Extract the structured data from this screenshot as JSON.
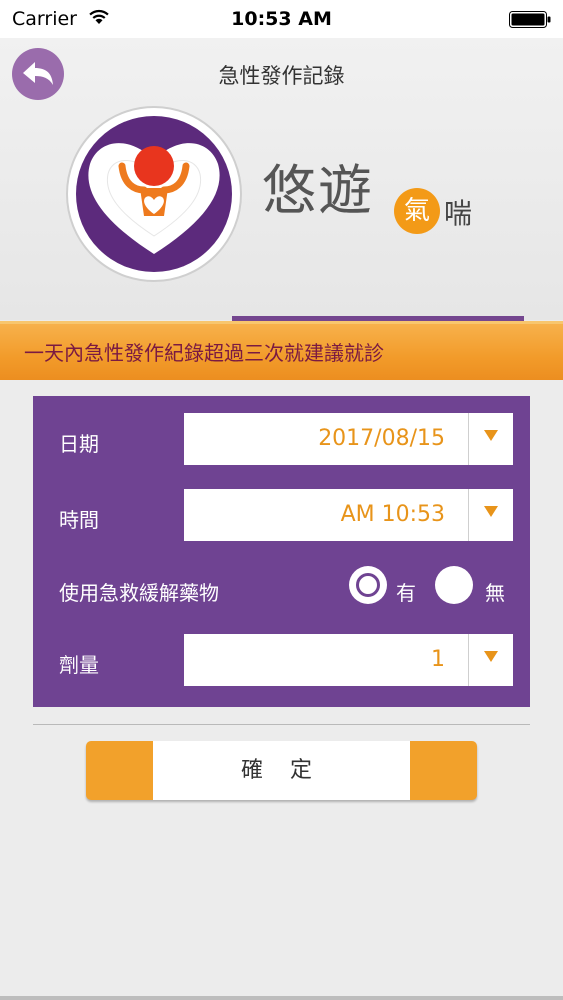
{
  "status_bar": {
    "carrier": "Carrier",
    "time": "10:53 AM"
  },
  "header": {
    "title": "急性發作記錄",
    "brand_main": "悠遊",
    "brand_badge": "氣",
    "brand_sub": "喘"
  },
  "banner": {
    "text": "一天內急性發作紀錄超過三次就建議就診"
  },
  "form": {
    "date": {
      "label": "日期",
      "value": "2017/08/15"
    },
    "time": {
      "label": "時間",
      "value": "AM 10:53"
    },
    "rescue_med": {
      "label": "使用急救緩解藥物",
      "options": [
        {
          "label": "有",
          "selected": true
        },
        {
          "label": "無",
          "selected": false
        }
      ]
    },
    "dose": {
      "label": "劑量",
      "value": "1"
    }
  },
  "actions": {
    "confirm_label": "確 定"
  },
  "colors": {
    "purple": "#6f4392",
    "orange": "#f2a12b",
    "value_text": "#e8941a",
    "banner_text": "#7a1a42"
  }
}
